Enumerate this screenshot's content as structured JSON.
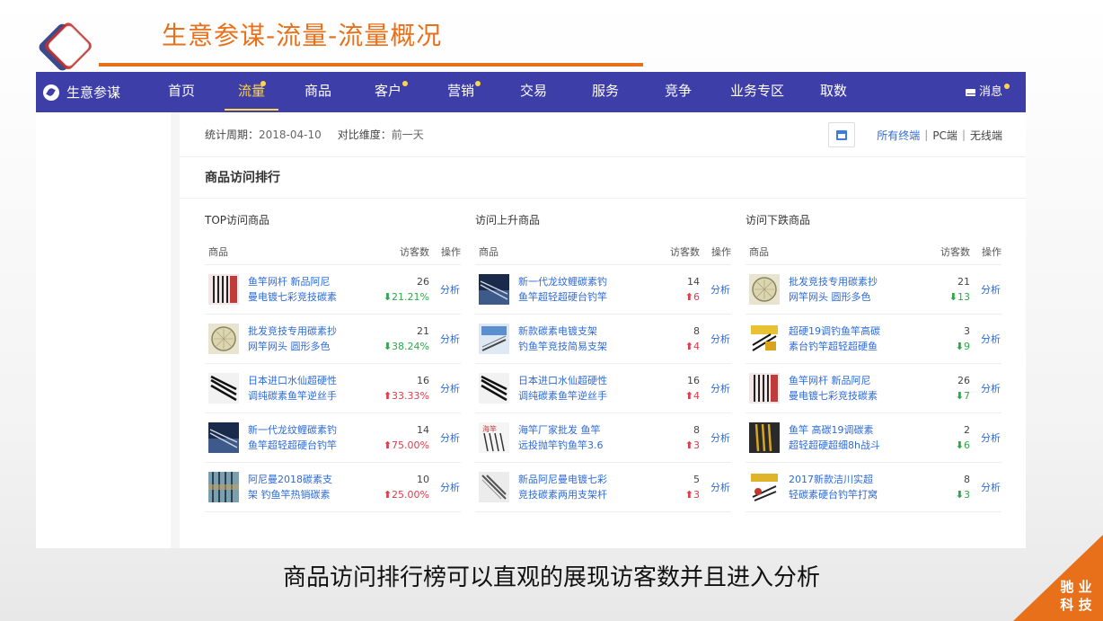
{
  "slide": {
    "title": "生意参谋-流量-流量概况",
    "caption": "商品访问排行榜可以直观的展现访客数并且进入分析",
    "corner_line1": "驰 业",
    "corner_line2": "科 技"
  },
  "nav": {
    "brand": "生意参谋",
    "items": [
      {
        "label": "首页"
      },
      {
        "label": "流量"
      },
      {
        "label": "商品"
      },
      {
        "label": "客户"
      },
      {
        "label": "营销"
      },
      {
        "label": "交易"
      },
      {
        "label": "服务"
      },
      {
        "label": "竞争"
      },
      {
        "label": "业务专区"
      },
      {
        "label": "取数"
      }
    ],
    "active": "流量",
    "message": "消息"
  },
  "filter": {
    "period_label": "统计周期：",
    "period_value": "2018-04-10",
    "compare_label": "对比维度：",
    "compare_value": "前一天",
    "terminal_all": "所有终端",
    "terminal_pc": "PC端",
    "terminal_wireless": "无线端"
  },
  "section_title": "商品访问排行",
  "columns": {
    "product": "商品",
    "visitors": "访客数",
    "action": "操作"
  },
  "action_label": "分析",
  "panels": [
    {
      "title": "TOP访问商品",
      "rows": [
        {
          "name1": "鱼竿网杆 新品阿尼",
          "name2": "曼电镀七彩竞技碳素",
          "visitors": "26",
          "change": "21.21%",
          "dir": "down",
          "thumb": "rod-red"
        },
        {
          "name1": "批发竞技专用碳素抄",
          "name2": "网竿网头 圆形多色",
          "visitors": "21",
          "change": "38.24%",
          "dir": "down",
          "thumb": "net"
        },
        {
          "name1": "日本进口水仙超硬性",
          "name2": "调纯碳素鱼竿逆丝手",
          "visitors": "16",
          "change": "33.33%",
          "dir": "up",
          "thumb": "rod-black"
        },
        {
          "name1": "新一代龙纹鲤碳素钓",
          "name2": "鱼竿超轻超硬台钓竿",
          "visitors": "14",
          "change": "75.00%",
          "dir": "up",
          "thumb": "rod-blue"
        },
        {
          "name1": "阿尼曼2018碳素支",
          "name2": "架 钓鱼竿热销碳素",
          "visitors": "10",
          "change": "25.00%",
          "dir": "up",
          "thumb": "rod-pattern"
        }
      ]
    },
    {
      "title": "访问上升商品",
      "rows": [
        {
          "name1": "新一代龙纹鲤碳素钓",
          "name2": "鱼竿超轻超硬台钓竿",
          "visitors": "14",
          "change": "6",
          "dir": "up",
          "thumb": "rod-blue"
        },
        {
          "name1": "新款碳素电镀支架",
          "name2": "钓鱼竿竞技简易支架",
          "visitors": "8",
          "change": "4",
          "dir": "up",
          "thumb": "stand"
        },
        {
          "name1": "日本进口水仙超硬性",
          "name2": "调纯碳素鱼竿逆丝手",
          "visitors": "16",
          "change": "4",
          "dir": "up",
          "thumb": "rod-black"
        },
        {
          "name1": "海竿厂家批发 鱼竿",
          "name2": "远投抛竿钓鱼竿3.6",
          "visitors": "8",
          "change": "3",
          "dir": "up",
          "thumb": "sea-rod"
        },
        {
          "name1": "新品阿尼曼电镀七彩",
          "name2": "竞技碳素两用支架杆",
          "visitors": "5",
          "change": "3",
          "dir": "up",
          "thumb": "rod-gray"
        }
      ]
    },
    {
      "title": "访问下跌商品",
      "rows": [
        {
          "name1": "批发竞技专用碳素抄",
          "name2": "网竿网头 圆形多色",
          "visitors": "21",
          "change": "13",
          "dir": "down",
          "thumb": "net"
        },
        {
          "name1": "超硬19调钓鱼竿高碳",
          "name2": "素台钓竿超轻超硬鱼",
          "visitors": "3",
          "change": "9",
          "dir": "down",
          "thumb": "box-yellow"
        },
        {
          "name1": "鱼竿网杆 新品阿尼",
          "name2": "曼电镀七彩竞技碳素",
          "visitors": "26",
          "change": "7",
          "dir": "down",
          "thumb": "rod-red"
        },
        {
          "name1": "鱼竿 高碳19调碳素",
          "name2": "超轻超硬超细8h战斗",
          "visitors": "2",
          "change": "6",
          "dir": "down",
          "thumb": "rod-gold"
        },
        {
          "name1": "2017新款洁川实超",
          "name2": "轻碳素硬台钓竿打窝",
          "visitors": "8",
          "change": "3",
          "dir": "down",
          "thumb": "box-yellow2"
        }
      ]
    }
  ],
  "colors": {
    "nav_bg": "#3e3ea8",
    "accent_orange": "#e9701a",
    "link_blue": "#2e6bd8",
    "up_red": "#e03c4b",
    "down_green": "#2ea84a",
    "active_yellow": "#ffd54a"
  }
}
